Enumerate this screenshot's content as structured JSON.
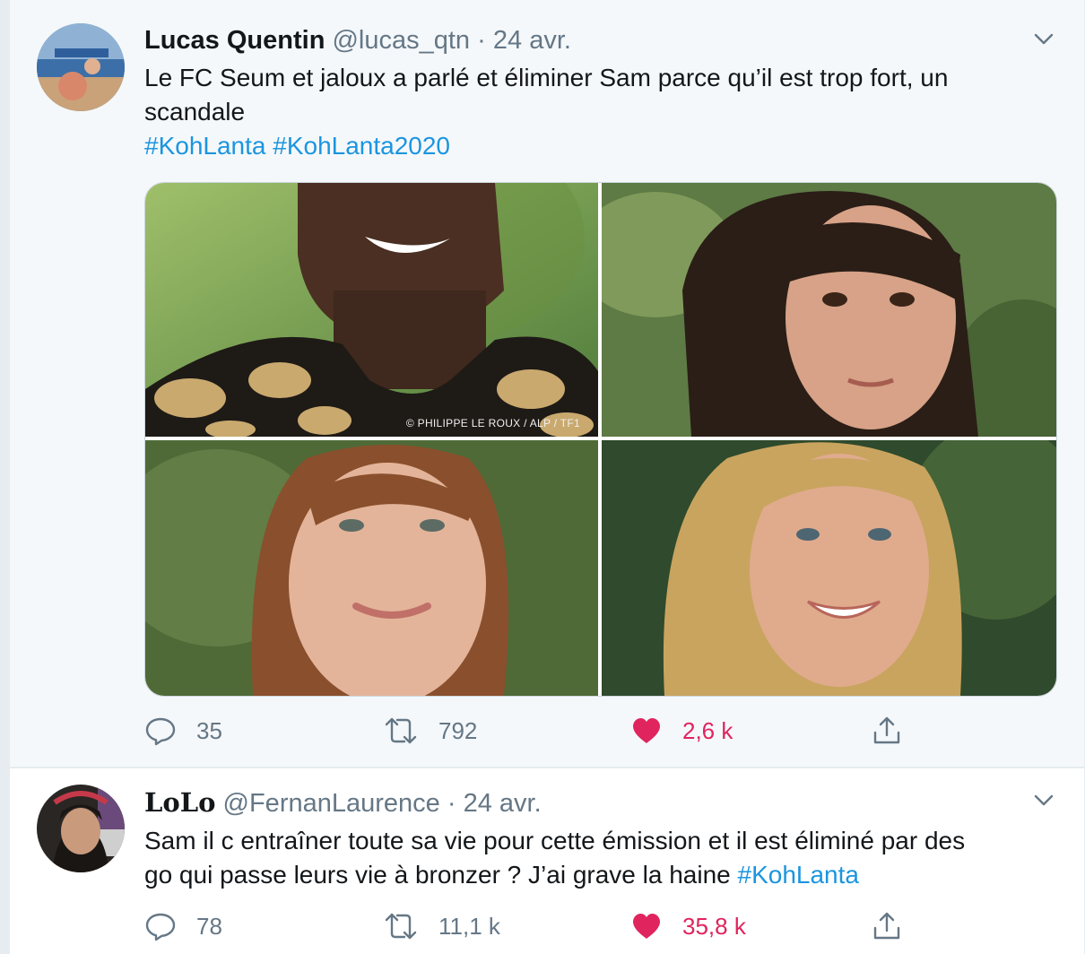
{
  "tweets": [
    {
      "author_name": "Lucas Quentin",
      "handle": "@lucas_qtn",
      "separator": "·",
      "date": "24 avr.",
      "text_line1": "Le FC Seum et jaloux a parlé et éliminer Sam parce qu’il est trop fort, un",
      "text_line2": "scandale",
      "hashtags": [
        "#KohLanta",
        "#KohLanta2020"
      ],
      "photo_credit": "© PHILIPPE LE ROUX / ALP / TF1",
      "replies": "35",
      "retweets": "792",
      "likes": "2,6 k",
      "liked": true
    },
    {
      "author_name": "LoLo",
      "handle": "@FernanLaurence",
      "separator": "·",
      "date": "24 avr.",
      "text_line1": "Sam il c entraîner toute sa vie pour cette émission et il est éliminé par des",
      "text_line2": "go qui passe leurs vie à bronzer ? J’ai grave la haine",
      "hashtags": [
        "#KohLanta"
      ],
      "replies": "78",
      "retweets": "11,1 k",
      "likes": "35,8 k",
      "liked": true
    }
  ],
  "icons": {
    "reply": "reply-icon",
    "retweet": "retweet-icon",
    "like": "heart-icon",
    "share": "share-icon",
    "more": "chevron-down-icon"
  },
  "colors": {
    "accent": "#1b95e0",
    "like": "#e0245e",
    "muted": "#657786"
  }
}
